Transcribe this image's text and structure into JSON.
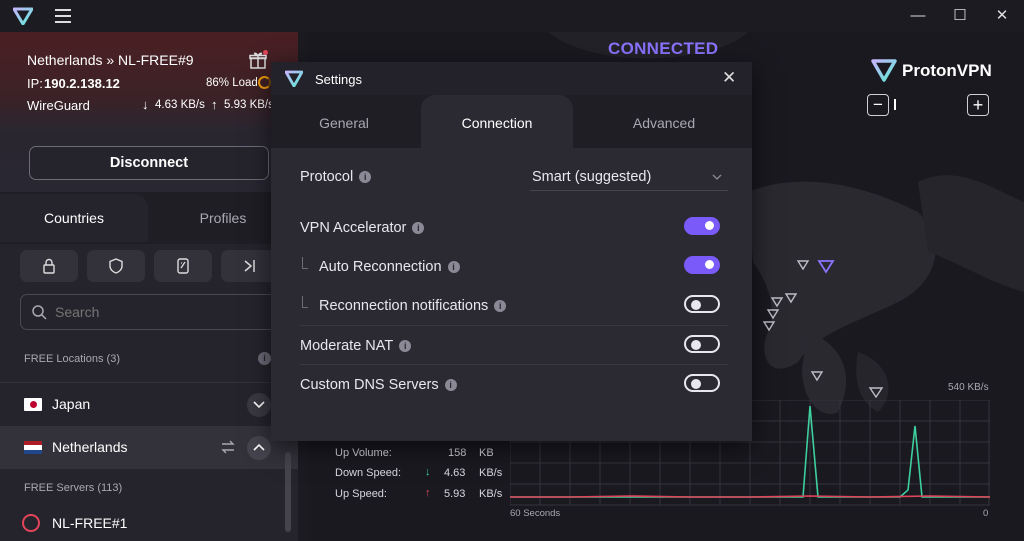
{
  "window": {
    "minimize": "—",
    "maximize": "☐",
    "close": "✕"
  },
  "connection": {
    "server": "Netherlands » NL-FREE#9",
    "ip_label": "IP:",
    "ip": "190.2.138.12",
    "load": "86% Load",
    "protocol": "WireGuard",
    "down": "4.63 KB/s",
    "up": "5.93 KB/s",
    "disconnect": "Disconnect"
  },
  "tabs": {
    "countries": "Countries",
    "profiles": "Profiles"
  },
  "search": {
    "placeholder": "Search"
  },
  "list": {
    "free_locations": "FREE Locations (3)",
    "countries": [
      {
        "name": "Japan"
      },
      {
        "name": "Netherlands"
      }
    ],
    "free_servers": "FREE Servers (113)",
    "servers": [
      {
        "name": "NL-FREE#1"
      }
    ]
  },
  "map": {
    "status": "CONNECTED",
    "brand": "ProtonVPN",
    "zoom_out": "−",
    "zoom_in": "+"
  },
  "graph": {
    "max_label": "540  KB/s",
    "left_label": "60 Seconds",
    "right_label": "0",
    "stats": [
      {
        "label": "Up Volume:",
        "arrow": "",
        "value": "158",
        "unit": "KB"
      },
      {
        "label": "Down Speed:",
        "arrow": "↓",
        "value": "4.63",
        "unit": "KB/s"
      },
      {
        "label": "Up Speed:",
        "arrow": "↑",
        "value": "5.93",
        "unit": "KB/s"
      }
    ],
    "colors": {
      "down": "#3ecf9e",
      "up": "#e2455a"
    }
  },
  "settings": {
    "title": "Settings",
    "tabs": [
      "General",
      "Connection",
      "Advanced"
    ],
    "active_tab": "Connection",
    "protocol_label": "Protocol",
    "protocol_value": "Smart (suggested)",
    "rows": [
      {
        "label": "VPN Accelerator",
        "on": true
      },
      {
        "label": "Auto Reconnection",
        "on": true
      },
      {
        "label": "Reconnection notifications",
        "on": false
      },
      {
        "label": "Moderate NAT",
        "on": false
      },
      {
        "label": "Custom DNS Servers",
        "on": false
      }
    ]
  },
  "accent": "#7a5af8"
}
